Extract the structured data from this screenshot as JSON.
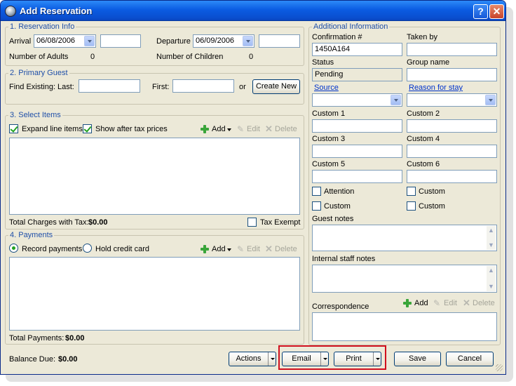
{
  "window": {
    "title": "Add Reservation",
    "help_label": "?",
    "close_label": "✕"
  },
  "reservation": {
    "section_title": "1. Reservation Info",
    "arrival_label": "Arrival",
    "arrival_date": "06/08/2006",
    "arrival_time": "",
    "departure_label": "Departure",
    "departure_date": "06/09/2006",
    "departure_time": "",
    "adults_label": "Number of Adults",
    "adults_value": "0",
    "children_label": "Number of Children",
    "children_value": "0"
  },
  "guest": {
    "section_title": "2. Primary Guest",
    "find_label": "Find Existing:",
    "last_label": "Last:",
    "last_value": "",
    "first_label": "First:",
    "first_value": "",
    "or_label": "or",
    "create_new_label": "Create New"
  },
  "items": {
    "section_title": "3. Select Items",
    "expand_label": "Expand line items",
    "show_after_tax_label": "Show after tax prices",
    "add_label": "Add",
    "edit_label": "Edit",
    "delete_label": "Delete",
    "total_label": "Total Charges with Tax:",
    "total_value": "$0.00",
    "tax_exempt_label": "Tax Exempt"
  },
  "payments": {
    "section_title": "4. Payments",
    "record_label": "Record payments",
    "hold_label": "Hold credit card",
    "add_label": "Add",
    "edit_label": "Edit",
    "delete_label": "Delete",
    "total_label": "Total Payments:",
    "total_value": "$0.00"
  },
  "footer": {
    "balance_label": "Balance Due:",
    "balance_value": "$0.00",
    "actions_label": "Actions",
    "email_label": "Email",
    "print_label": "Print",
    "save_label": "Save",
    "cancel_label": "Cancel"
  },
  "additional": {
    "section_title": "Additional Information",
    "confirmation_label": "Confirmation #",
    "confirmation_value": "1450A164",
    "taken_by_label": "Taken by",
    "taken_by_value": "",
    "status_label": "Status",
    "status_value": "Pending",
    "group_name_label": "Group name",
    "group_name_value": "",
    "source_label": "Source",
    "reason_label": "Reason for stay",
    "custom1_label": "Custom 1",
    "custom2_label": "Custom 2",
    "custom3_label": "Custom 3",
    "custom4_label": "Custom 4",
    "custom5_label": "Custom 5",
    "custom6_label": "Custom 6",
    "attention_label": "Attention",
    "custom_check_label": "Custom",
    "guest_notes_label": "Guest notes",
    "staff_notes_label": "Internal staff notes",
    "correspondence_label": "Correspondence",
    "add_label": "Add",
    "edit_label": "Edit",
    "delete_label": "Delete"
  },
  "colors": {
    "accent_highlight": "#d0101e",
    "titlebar": "#0b5ce2",
    "section_title": "#1f4fa8"
  }
}
